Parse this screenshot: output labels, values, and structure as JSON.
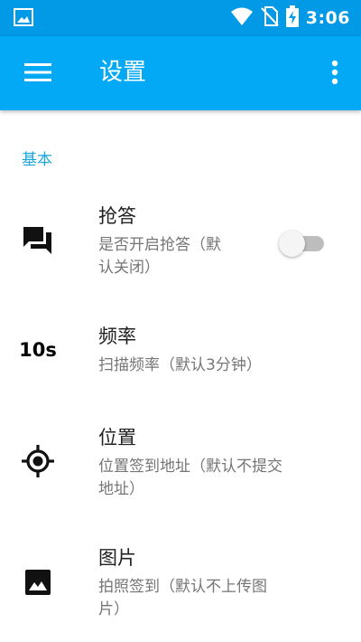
{
  "status_bar": {
    "time": "3:06",
    "icons": [
      "image-notification-icon",
      "wifi-icon",
      "no-sim-icon",
      "battery-charging-icon"
    ]
  },
  "app_bar": {
    "title": "设置",
    "menu_icon": "hamburger-menu-icon",
    "more_icon": "more-vert-icon",
    "color": "#03a9f4"
  },
  "section": {
    "header": "基本",
    "header_color": "#1aa5dc"
  },
  "settings": [
    {
      "icon": "question-answer-icon",
      "title": "抢答",
      "summary_lines": [
        "是否开启抢答（默",
        "认关闭）"
      ],
      "toggle_on": false
    },
    {
      "icon_text": "10s",
      "title": "频率",
      "summary_lines": [
        "扫描频率（默认3分钟）"
      ]
    },
    {
      "icon": "my-location-icon",
      "title": "位置",
      "summary_lines": [
        "位置签到地址（默认不提交",
        "地址）"
      ]
    },
    {
      "icon": "image-icon",
      "title": "图片",
      "summary_lines": [
        "拍照签到（默认不上传图",
        "片）"
      ]
    }
  ]
}
